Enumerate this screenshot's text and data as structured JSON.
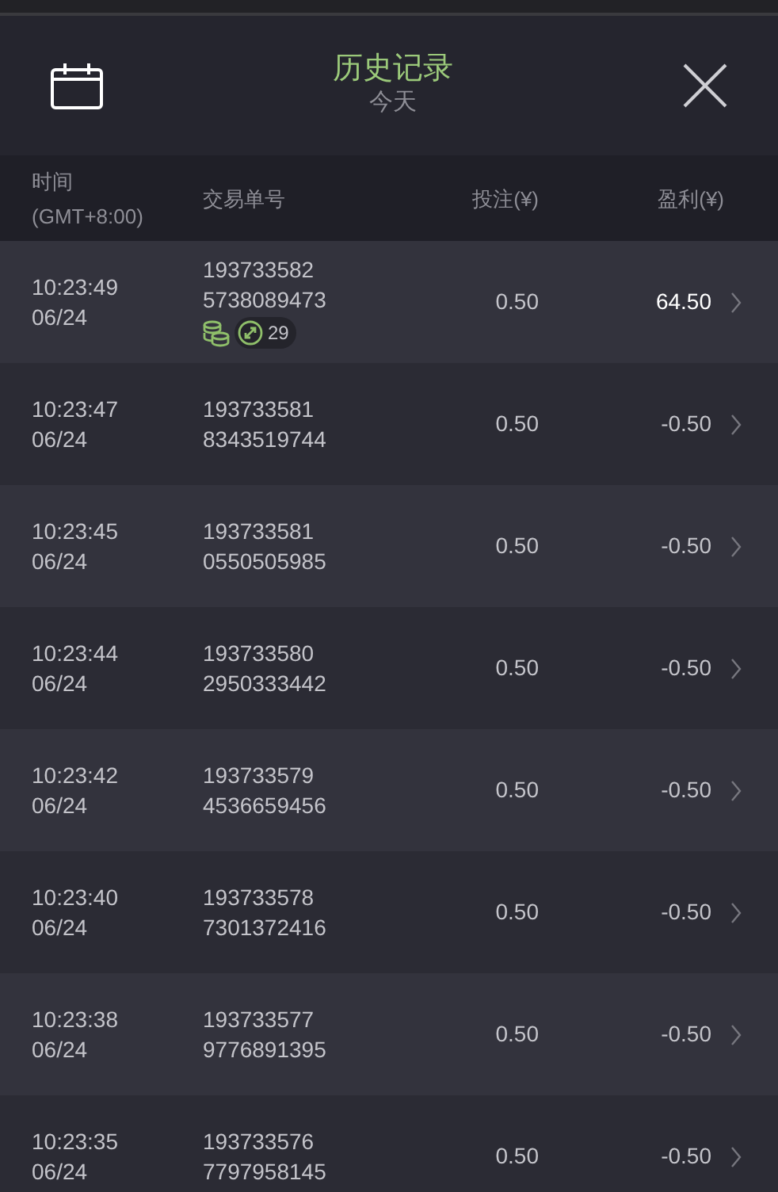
{
  "header": {
    "title": "历史记录",
    "subtitle": "今天"
  },
  "columns": [
    {
      "label": "时间",
      "sub": "(GMT+8:00)"
    },
    {
      "label": "交易单号"
    },
    {
      "label": "投注(¥)"
    },
    {
      "label": "盈利(¥)"
    }
  ],
  "rows": [
    {
      "time": "10:23:49",
      "date": "06/24",
      "id1": "193733582",
      "id2": "5738089473",
      "stake": "0.50",
      "profit": "64.50",
      "win": true,
      "badge": "29"
    },
    {
      "time": "10:23:47",
      "date": "06/24",
      "id1": "193733581",
      "id2": "8343519744",
      "stake": "0.50",
      "profit": "-0.50",
      "win": false
    },
    {
      "time": "10:23:45",
      "date": "06/24",
      "id1": "193733581",
      "id2": "0550505985",
      "stake": "0.50",
      "profit": "-0.50",
      "win": false
    },
    {
      "time": "10:23:44",
      "date": "06/24",
      "id1": "193733580",
      "id2": "2950333442",
      "stake": "0.50",
      "profit": "-0.50",
      "win": false
    },
    {
      "time": "10:23:42",
      "date": "06/24",
      "id1": "193733579",
      "id2": "4536659456",
      "stake": "0.50",
      "profit": "-0.50",
      "win": false
    },
    {
      "time": "10:23:40",
      "date": "06/24",
      "id1": "193733578",
      "id2": "7301372416",
      "stake": "0.50",
      "profit": "-0.50",
      "win": false
    },
    {
      "time": "10:23:38",
      "date": "06/24",
      "id1": "193733577",
      "id2": "9776891395",
      "stake": "0.50",
      "profit": "-0.50",
      "win": false
    },
    {
      "time": "10:23:35",
      "date": "06/24",
      "id1": "193733576",
      "id2": "7797958145",
      "stake": "0.50",
      "profit": "-0.50",
      "win": false
    }
  ]
}
